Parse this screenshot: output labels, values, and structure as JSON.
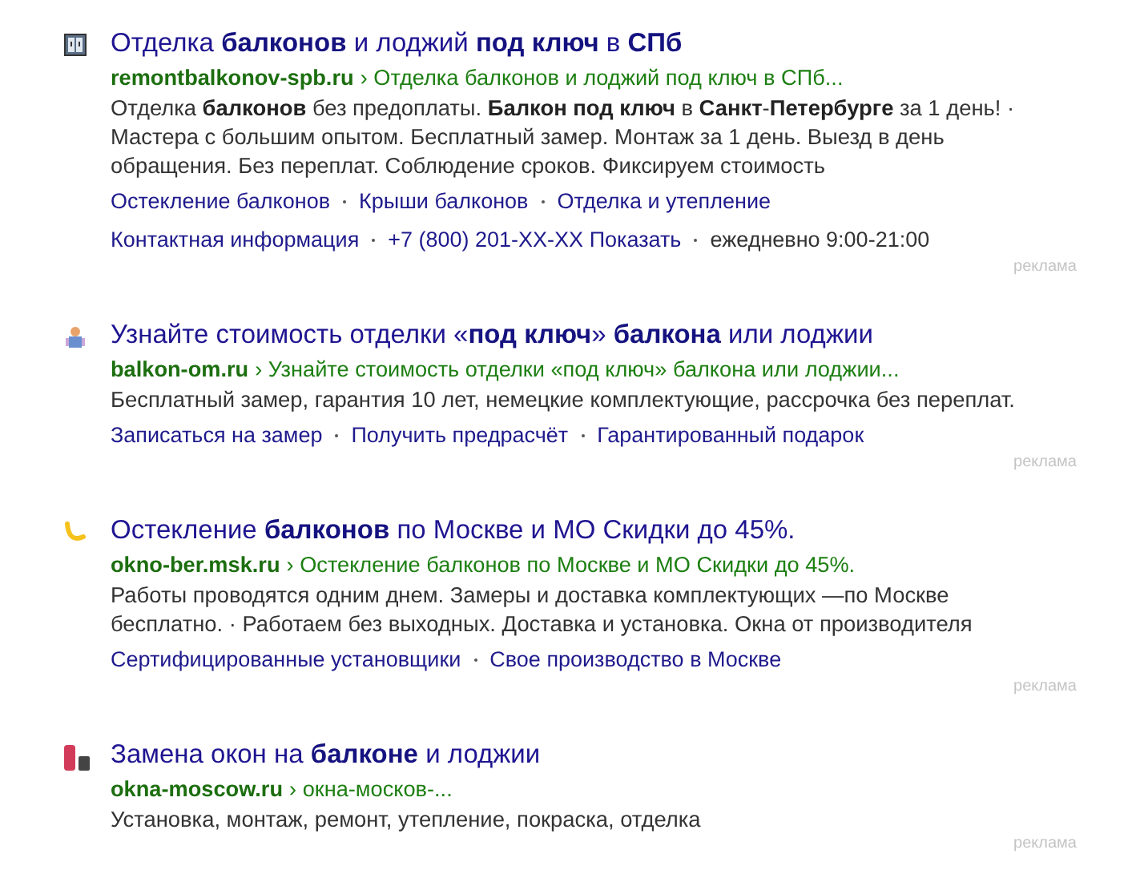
{
  "ads": [
    {
      "title": "Отделка **балконов** и лоджий **под ключ** в **СПб**",
      "domain": "remontbalkonov-spb.ru",
      "path": "› Отделка балконов и лоджий под ключ в СПб...",
      "text": "Отделка **балконов** без предоплаты. **Балкон под ключ** в **Санкт**-**Петербурге** за 1 день! · Мастера с большим опытом. Бесплатный замер. Монтаж за 1 день. Выезд в день обращения. Без переплат. Соблюдение сроков. Фиксируем стоимость",
      "sitelinks": [
        "Остекление балконов",
        "Крыши балконов",
        "Отделка и утепление"
      ],
      "contacts": [
        {
          "kind": "link",
          "text": "Контактная информация"
        },
        {
          "kind": "link",
          "text": "+7 (800) 201-XX-XX Показать"
        },
        {
          "kind": "plain",
          "text": "ежедневно 9:00-21:00"
        }
      ],
      "label": "реклама"
    },
    {
      "title": "Узнайте стоимость отделки «**под ключ**» **балкона** или лоджии",
      "domain": "balkon-om.ru",
      "path": "› Узнайте стоимость отделки «под ключ» балкона или лоджии...",
      "text": "Бесплатный замер, гарантия 10 лет, немецкие комплектующие, рассрочка без переплат.",
      "sitelinks": [
        "Записаться на замер",
        "Получить предрасчёт",
        "Гарантированный подарок"
      ],
      "label": "реклама"
    },
    {
      "title": "Остекление **балконов** по Москве и МО Скидки до 45%.",
      "domain": "okno-ber.msk.ru",
      "path": "› Остекление балконов по Москве и МО Скидки до 45%.",
      "text": "Работы проводятся одним днем. Замеры и доставка комплектующих —по Москве бесплатно. · Работаем без выходных. Доставка и установка. Окна от производителя",
      "sitelinks": [
        "Сертифицированные установщики",
        "Свое производство в Москве"
      ],
      "label": "реклама"
    },
    {
      "title": "Замена окон на **балконе** и лоджии",
      "domain": "okna-moscow.ru",
      "path": "› окна-москов-...",
      "text": "Установка, монтаж, ремонт, утепление, покраска, отделка",
      "label": "реклама"
    }
  ]
}
